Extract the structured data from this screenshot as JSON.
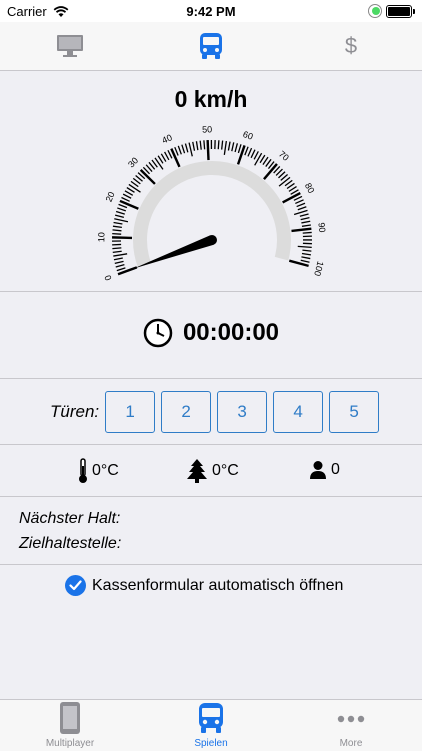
{
  "status_bar": {
    "carrier": "Carrier",
    "time": "9:42 PM"
  },
  "top_tabs": [
    {
      "name": "display",
      "icon": "monitor-icon",
      "active": false
    },
    {
      "name": "bus",
      "icon": "bus-icon",
      "active": true
    },
    {
      "name": "money",
      "icon": "dollar-icon",
      "active": false
    }
  ],
  "speedometer": {
    "speed_text": "0 km/h",
    "value": 0,
    "min": 0,
    "max": 100,
    "tick_labels": [
      "0",
      "10",
      "20",
      "30",
      "40",
      "50",
      "60",
      "70",
      "80",
      "90",
      "100"
    ]
  },
  "timer": {
    "value": "00:00:00",
    "icon": "clock-icon"
  },
  "doors": {
    "label": "Türen:",
    "buttons": [
      "1",
      "2",
      "3",
      "4",
      "5"
    ]
  },
  "environment": {
    "temperature_inside": "0°C",
    "temperature_outside": "0°C",
    "passengers": "0"
  },
  "stops": {
    "next_stop_label": "Nächster Halt:",
    "destination_label": "Zielhaltestelle:"
  },
  "auto_open": {
    "label": "Kassenformular automatisch öffnen",
    "checked": true
  },
  "tab_bar": [
    {
      "label": "Multiplayer",
      "icon": "phone-icon",
      "active": false
    },
    {
      "label": "Spielen",
      "icon": "bus-icon",
      "active": true
    },
    {
      "label": "More",
      "icon": "more-icon",
      "active": false
    }
  ],
  "colors": {
    "accent": "#1a73e8",
    "door_border": "#2f7cc7",
    "inactive": "#8e8e93"
  }
}
